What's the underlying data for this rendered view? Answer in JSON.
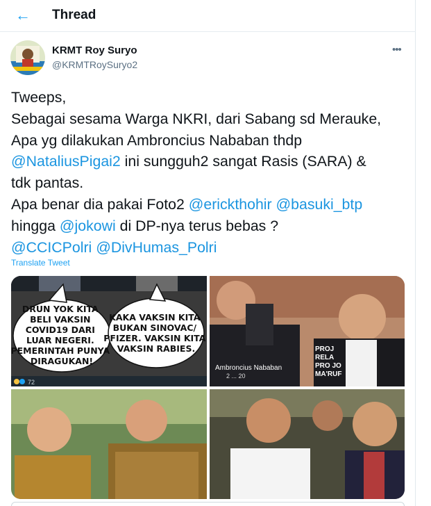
{
  "header": {
    "title": "Thread"
  },
  "tweet": {
    "author_name": "KRMT Roy Suryo",
    "author_handle": "@KRMTRoySuryo2",
    "line1": "Tweeps,",
    "line2": "Sebagai sesama Warga NKRI, dari Sabang sd Merauke,",
    "line3": "Apa yg dilakukan Ambroncius Nababan thdp",
    "line4_mention": "@NataliusPigai2",
    "line4_text": " ini sungguh2 sangat Rasis (SARA) &",
    "line5": "tdk pantas.",
    "line6_text": "Apa benar dia pakai Foto2 ",
    "line6_mention1": "@erickthohir",
    "line6_space": " ",
    "line6_mention2": "@basuki_btp",
    "line7_text1": "hingga ",
    "line7_mention": "@jokowi",
    "line7_text2": " di DP-nya terus bebas ?",
    "line8_mention1": "@CCICPolri",
    "line8_space": " ",
    "line8_mention2": "@DivHumas_Polri",
    "translate": "Translate Tweet"
  },
  "media": {
    "meme_left": [
      "DRUN YOK KITA",
      "BELI VAKSIN",
      "COVID19 DARI",
      "LUAR NEGERI.",
      "PEMERINTAH PUNYA",
      "DIRAGUKAN!"
    ],
    "meme_right": [
      "KAKA VAKSIN KITA",
      "BUKAN SINOVAC/",
      "PFIZER. VAKSIN KITA",
      "VAKSIN RABIES."
    ],
    "meme_reactions": "72",
    "photo_caption": "Ambroncius Nababan",
    "photo_date": "2 ... 20",
    "shirt_text": [
      "PROJ",
      "RELA",
      "PRO JO",
      "MA'RUF"
    ]
  },
  "colors": {
    "accent": "#1da1f2",
    "mention": "#1b95e0",
    "muted": "#5b7083"
  }
}
